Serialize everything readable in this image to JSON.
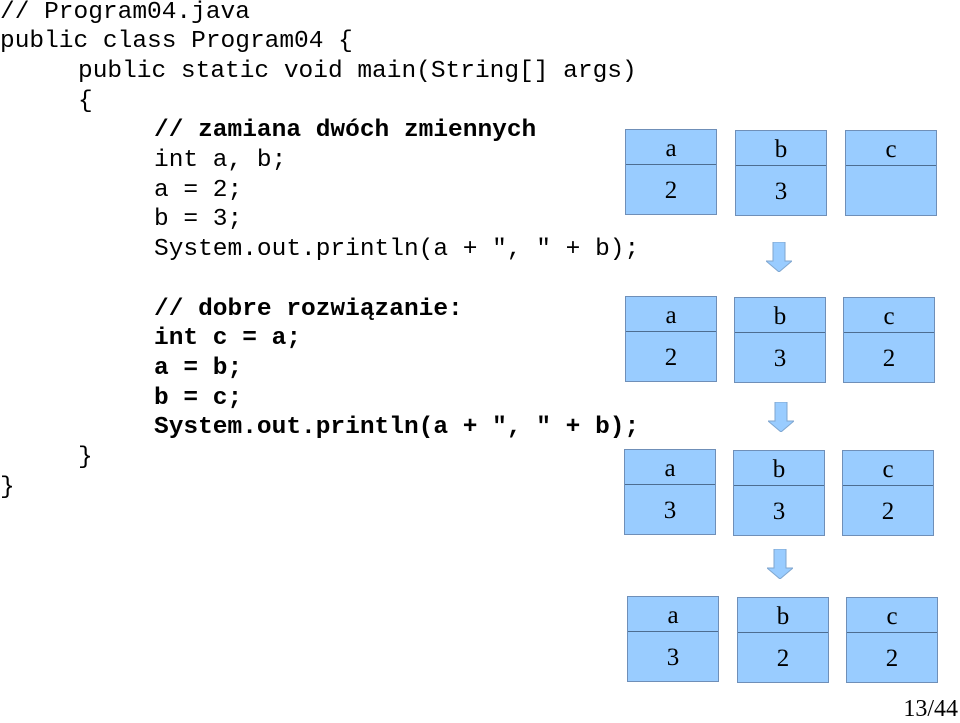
{
  "code_lines": [
    {
      "text": "// Program04.java",
      "indent": 0,
      "bold": false
    },
    {
      "text": "public class Program04 {",
      "indent": 0,
      "bold": false
    },
    {
      "text": "public static void main(String[] args)",
      "indent": 1,
      "bold": false
    },
    {
      "text": "{",
      "indent": 1,
      "bold": false
    },
    {
      "text": "// zamiana dwóch zmiennych",
      "indent": 2,
      "bold": true
    },
    {
      "text": "int a, b;",
      "indent": 2,
      "bold": false
    },
    {
      "text": "a = 2;",
      "indent": 2,
      "bold": false
    },
    {
      "text": "b = 3;",
      "indent": 2,
      "bold": false
    },
    {
      "text": "System.out.println(a + \", \" + b);",
      "indent": 2,
      "bold": false
    },
    {
      "text": "// dobre rozwiązanie:",
      "indent": 2,
      "bold": true
    },
    {
      "text": "int c = a;",
      "indent": 2,
      "bold": true
    },
    {
      "text": "a = b;",
      "indent": 2,
      "bold": true
    },
    {
      "text": "b = c;",
      "indent": 2,
      "bold": true
    },
    {
      "text": "System.out.println(a + \", \" + b);",
      "indent": 2,
      "bold": true
    },
    {
      "text": "}",
      "indent": 1,
      "bold": false
    },
    {
      "text": "}",
      "indent": 0,
      "bold": false
    }
  ],
  "states": [
    {
      "vars": [
        {
          "name": "a",
          "value": "2"
        },
        {
          "name": "b",
          "value": "3"
        },
        {
          "name": "c",
          "value": ""
        }
      ]
    },
    {
      "vars": [
        {
          "name": "a",
          "value": "2"
        },
        {
          "name": "b",
          "value": "3"
        },
        {
          "name": "c",
          "value": "2"
        }
      ]
    },
    {
      "vars": [
        {
          "name": "a",
          "value": "3"
        },
        {
          "name": "b",
          "value": "3"
        },
        {
          "name": "c",
          "value": "2"
        }
      ]
    },
    {
      "vars": [
        {
          "name": "a",
          "value": "3"
        },
        {
          "name": "b",
          "value": "2"
        },
        {
          "name": "c",
          "value": "2"
        }
      ]
    }
  ],
  "colors": {
    "box_fill": "#99ccff",
    "box_border": "#6f8fb8",
    "arrow_fill": "#99ccff"
  },
  "page_number": "13/44"
}
